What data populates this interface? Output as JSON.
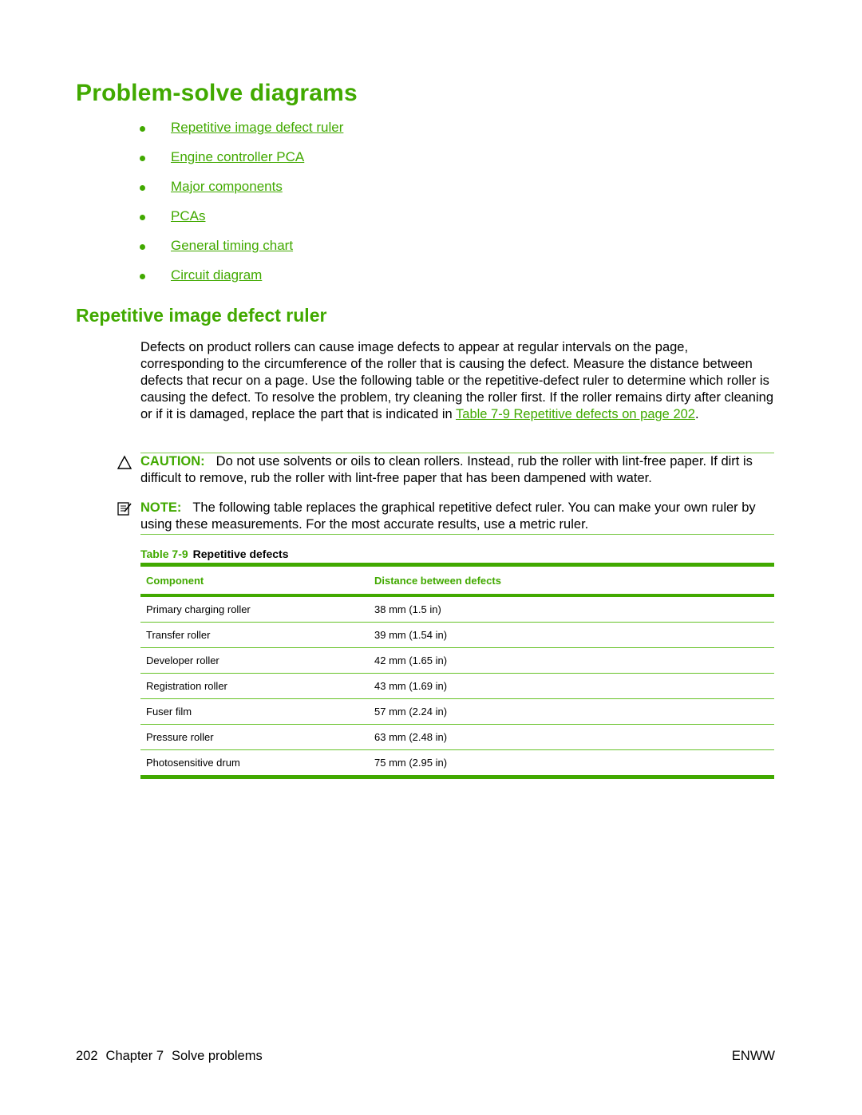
{
  "title": "Problem-solve diagrams",
  "toc": [
    {
      "label": "Repetitive image defect ruler"
    },
    {
      "label": "Engine controller PCA"
    },
    {
      "label": "Major components"
    },
    {
      "label": "PCAs"
    },
    {
      "label": "General timing chart"
    },
    {
      "label": "Circuit diagram"
    }
  ],
  "section": {
    "heading": "Repetitive image defect ruler",
    "body_text": "Defects on product rollers can cause image defects to appear at regular intervals on the page, corresponding to the circumference of the roller that is causing the defect. Measure the distance between defects that recur on a page. Use the following table or the repetitive-defect ruler to determine which roller is causing the defect. To resolve the problem, try cleaning the roller first. If the roller remains dirty after cleaning or if it is damaged, replace the part that is indicated in ",
    "body_link": "Table 7-9 Repetitive defects on page 202",
    "body_end": "."
  },
  "caution": {
    "label": "CAUTION:",
    "text": "Do not use solvents or oils to clean rollers. Instead, rub the roller with lint-free paper. If dirt is difficult to remove, rub the roller with lint-free paper that has been dampened with water."
  },
  "note": {
    "label": "NOTE:",
    "text": "The following table replaces the graphical repetitive defect ruler. You can make your own ruler by using these measurements. For the most accurate results, use a metric ruler."
  },
  "table": {
    "number": "Table 7-9",
    "title": "Repetitive defects",
    "headers": [
      "Component",
      "Distance between defects"
    ],
    "rows": [
      [
        "Primary charging roller",
        "38 mm (1.5 in)"
      ],
      [
        "Transfer roller",
        "39 mm (1.54 in)"
      ],
      [
        "Developer roller",
        "42 mm (1.65 in)"
      ],
      [
        "Registration roller",
        "43 mm (1.69 in)"
      ],
      [
        "Fuser film",
        "57 mm (2.24 in)"
      ],
      [
        "Pressure roller",
        "63 mm (2.48 in)"
      ],
      [
        "Photosensitive drum",
        "75 mm (2.95 in)"
      ]
    ]
  },
  "footer": {
    "page_number": "202",
    "chapter": "Chapter 7",
    "chapter_title": "Solve problems",
    "right": "ENWW"
  },
  "colors": {
    "accent": "#41a900"
  }
}
